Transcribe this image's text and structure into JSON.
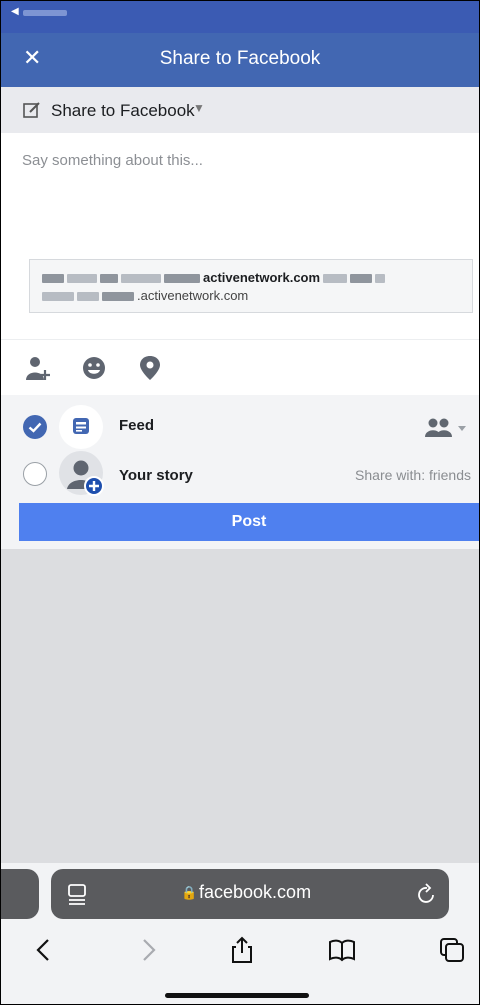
{
  "nav": {
    "title": "Share to Facebook",
    "close_icon": "close-icon"
  },
  "selector": {
    "label": "Share to Facebook",
    "icon": "edit-icon"
  },
  "composer": {
    "placeholder": "Say something about this...",
    "link_line1_suffix": "activenetwork.com",
    "link_line2_suffix": ".activenetwork.com"
  },
  "tools": [
    "tag-people-icon",
    "feeling-icon",
    "location-icon"
  ],
  "audience": {
    "feed": {
      "label": "Feed",
      "checked": true
    },
    "story": {
      "label": "Your story",
      "checked": false,
      "share_with": "Share with: friends"
    }
  },
  "post_label": "Post",
  "browser": {
    "url": "facebook.com"
  },
  "colors": {
    "brand": "#4267b2",
    "post": "#4f80ef"
  }
}
